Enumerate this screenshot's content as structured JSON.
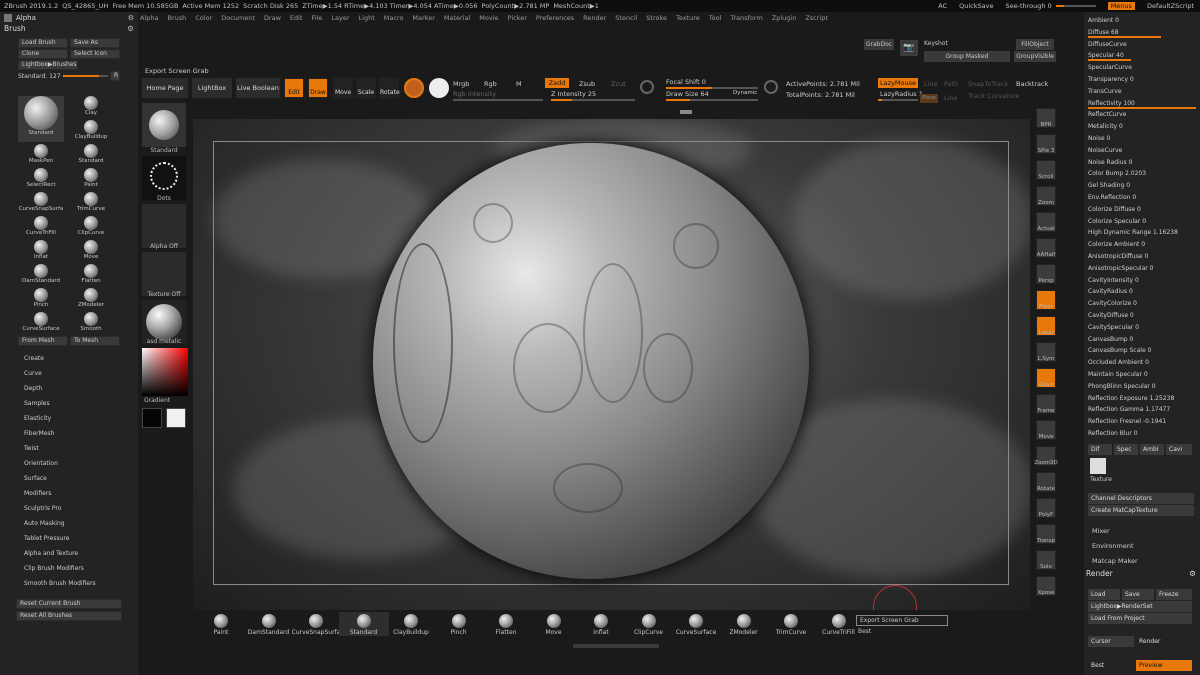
{
  "title_bar": {
    "app": "ZBrush 2019.1.2",
    "file": "QS_42865_UH",
    "free_mem": "Free Mem 10.585GB",
    "active_mem": "Active Mem 1252",
    "scratch": "Scratch Disk 265",
    "ztime": "ZTime▶1.54 RTime▶4.103 Timer▶4.054 ATime▶0.056",
    "polycount": "PolyCount▶2.781 MP",
    "meshcount": "MeshCount▶1",
    "ac": "AC",
    "quicksave": "QuickSave",
    "see_through": "See-through  0",
    "menus": "Menus",
    "script": "DefaultZScript"
  },
  "menu_bar": [
    "Alpha",
    "Brush",
    "Color",
    "Document",
    "Draw",
    "Edit",
    "File",
    "Layer",
    "Light",
    "Macro",
    "Marker",
    "Material",
    "Movie",
    "Picker",
    "Preferences",
    "Render",
    "Stencil",
    "Stroke",
    "Texture",
    "Tool",
    "Transform",
    "Zplugin",
    "Zscript"
  ],
  "left_panel": {
    "alpha_title": "Alpha",
    "brush_title": "Brush",
    "buttons": [
      [
        "Load Brush",
        "Save As"
      ],
      [
        "Clone",
        "Select Icon"
      ]
    ],
    "lightbox_brushes": "Lightbox▶Brushes",
    "standard_label": "Standard. 127",
    "r_label": "R",
    "brushes": [
      {
        "label": "Standard",
        "col": 0,
        "row": 0,
        "big": true
      },
      {
        "label": "Clay",
        "col": 1,
        "row": 0
      },
      {
        "label": "ClayBuildup",
        "col": 1,
        "row": 1
      },
      {
        "label": "MaskPen",
        "col": 0,
        "row": 2
      },
      {
        "label": "Standard",
        "col": 1,
        "row": 2
      },
      {
        "label": "SelectRect",
        "col": 0,
        "row": 3
      },
      {
        "label": "Paint",
        "col": 1,
        "row": 3
      },
      {
        "label": "CurveSnapSurfa",
        "col": 0,
        "row": 4
      },
      {
        "label": "TrimCurve",
        "col": 1,
        "row": 4
      },
      {
        "label": "CurveTriFill",
        "col": 0,
        "row": 5
      },
      {
        "label": "ClipCurve",
        "col": 1,
        "row": 5
      },
      {
        "label": "Inflat",
        "col": 0,
        "row": 6
      },
      {
        "label": "Move",
        "col": 1,
        "row": 6
      },
      {
        "label": "DamStandard",
        "col": 0,
        "row": 7
      },
      {
        "label": "Flatten",
        "col": 1,
        "row": 7
      },
      {
        "label": "Pinch",
        "col": 0,
        "row": 8
      },
      {
        "label": "ZModeler",
        "col": 1,
        "row": 8
      },
      {
        "label": "CurveSurface",
        "col": 0,
        "row": 9
      },
      {
        "label": "Smooth",
        "col": 1,
        "row": 9
      }
    ],
    "from_mesh": "From Mesh",
    "to_mesh": "To Mesh",
    "subpalettes": [
      "Create",
      "Curve",
      "Depth",
      "Samples",
      "Elasticity",
      "FiberMesh",
      "Twist",
      "Orientation",
      "Surface",
      "Modifiers",
      "Sculptris Pro",
      "Auto Masking",
      "Tablet Pressure",
      "Alpha and Texture",
      "Clip Brush Modifiers",
      "Smooth Brush Modifiers"
    ],
    "reset_current": "Reset Current Brush",
    "reset_all": "Reset All Brushes"
  },
  "left_shelf": {
    "standard": "Standard",
    "dots": "Dots",
    "alpha_off": "Alpha Off",
    "texture_off": "Texture Off",
    "material": "asd metalic",
    "gradient": "Gradient"
  },
  "toolbar": {
    "export_screen_grab": "Export Screen Grab",
    "home_page": "Home Page",
    "lightbox": "LightBox",
    "live_boolean": "Live Boolean",
    "edit": "Edit",
    "draw": "Draw",
    "move": "Move",
    "scale": "Scale",
    "rotate": "Rotate",
    "mrgb": "Mrgb",
    "rgb": "Rgb",
    "m": "M",
    "zadd": "Zadd",
    "zsub": "Zsub",
    "zcut": "Zcut",
    "rgb_intensity": "Rgb Intensity",
    "z_intensity": "Z Intensity 25",
    "focal_shift": "Focal Shift  0",
    "draw_size": "Draw Size  64",
    "dynamic": "Dynamic",
    "active_points": "ActivePoints: 2.781 Mil",
    "total_points": "TotalPoints: 2.781 Mil",
    "lazymouse": "LazyMouse",
    "lazyradius": "LazyRadius 1",
    "line": "Line",
    "path": "Path",
    "snaptotrack": "SnapToTrack",
    "backtrack": "Backtrack",
    "plane": "Plane",
    "line2": "Line",
    "track_curvature": "Track Curvature",
    "grabdoc": "GrabDoc",
    "keyshot": "Keyshot",
    "fillobject": "FillObject",
    "group_masked": "Group Masked",
    "group_visible": "GroupVisible"
  },
  "right_shelf": [
    "BPR",
    "SPix 3",
    "Scroll",
    "Zoom",
    "Actual",
    "AAHalf",
    "Persp",
    "Floor",
    "Local",
    "L.Sym",
    "Qxyz",
    "Frame",
    "Move",
    "Zoom3D",
    "Rotate",
    "PolyF",
    "Transp",
    "Solo",
    "Xpose"
  ],
  "right_panel": {
    "rows": [
      {
        "label": "Ambient 0",
        "fill": 0.0
      },
      {
        "label": "Diffuse 68",
        "fill": 0.68
      },
      {
        "label": "DiffuseCurve",
        "fill": 0
      },
      {
        "label": "Specular 40",
        "fill": 0.4
      },
      {
        "label": "SpecularCurve",
        "fill": 0
      },
      {
        "label": "Transparency 0",
        "fill": 0
      },
      {
        "label": "TransCurve",
        "fill": 0
      },
      {
        "label": "Reflectivity 100",
        "fill": 1.0
      },
      {
        "label": "ReflectCurve",
        "fill": 0
      },
      {
        "label": "Metalicity 0",
        "fill": 0
      },
      {
        "label": "Noise 0",
        "fill": 0
      },
      {
        "label": "NoiseCurve",
        "fill": 0
      },
      {
        "label": "Noise Radius 0",
        "fill": 0
      },
      {
        "label": "Color Bump 2.0203",
        "fill": 0
      },
      {
        "label": "Gel Shading 0",
        "fill": 0
      },
      {
        "label": "Env.Reflection 0",
        "fill": 0
      },
      {
        "label": "Colorize Diffuse 0",
        "fill": 0
      },
      {
        "label": "Colorize Specular 0",
        "fill": 0
      },
      {
        "label": "High Dynamic Range 1.16238",
        "fill": 0
      },
      {
        "label": "Colorize Ambient 0",
        "fill": 0
      },
      {
        "label": "AnisotropicDiffuse 0",
        "fill": 0
      },
      {
        "label": "AnisotropicSpecular 0",
        "fill": 0
      },
      {
        "label": "CavityIntensity 0",
        "fill": 0
      },
      {
        "label": "CavityRadius 0",
        "fill": 0
      },
      {
        "label": "CavityColorize 0",
        "fill": 0
      },
      {
        "label": "CavityDiffuse 0",
        "fill": 0
      },
      {
        "label": "CavitySpecular 0",
        "fill": 0
      },
      {
        "label": "CanvasBump 0",
        "fill": 0
      },
      {
        "label": "CanvasBump Scale 0",
        "fill": 0
      },
      {
        "label": "Occluded  Ambient 0",
        "fill": 0
      },
      {
        "label": "Maintain Specular 0",
        "fill": 0
      },
      {
        "label": "PhongBlinn Specular 0",
        "fill": 0
      },
      {
        "label": "Reflection Exposure 1.25238",
        "fill": 0
      },
      {
        "label": "Reflection Gamma 1.17477",
        "fill": 0
      },
      {
        "label": "Reflection Fresnel -0.1941",
        "fill": 0
      },
      {
        "label": "Reflection Blur 0",
        "fill": 0
      }
    ],
    "tabs": [
      "Dif",
      "Spec",
      "Ambi",
      "Cavi"
    ],
    "texture": "Texture",
    "channel_descriptors": "Channel Descriptors",
    "create_matcap": "Create MatCapTexture",
    "mixer": "Mixer",
    "environment": "Environment",
    "matcap_maker": "Matcap Maker",
    "render_title": "Render",
    "load": "Load",
    "save": "Save",
    "freeze": "Freeze",
    "lightbox_renderset": "Lightbox▶RenderSet",
    "load_from_project": "Load From Project",
    "cursor": "Cursor",
    "render": "Render",
    "best": "Best",
    "preview": "Preview"
  },
  "bottom_shelf": {
    "brushes": [
      "Paint",
      "DamStandard",
      "CurveSnapSurfa",
      "Standard",
      "ClayBuildup",
      "Pinch",
      "Flatten",
      "Move",
      "Inflat",
      "ClipCurve",
      "CurveSurface",
      "ZModeler",
      "TrimCurve",
      "CurveTriFill"
    ],
    "export_screen_grab": "Export Screen Grab",
    "best": "Best"
  },
  "colors": {
    "accent": "#e8780a",
    "panel": "#232323",
    "background": "#1a1a1a"
  }
}
